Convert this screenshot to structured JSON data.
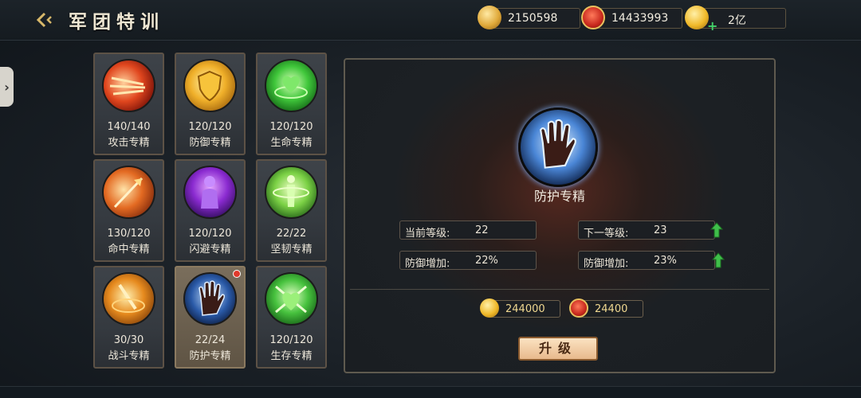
{
  "header": {
    "back_icon": "back-arrow-icon",
    "title": "军团特训"
  },
  "resources": [
    {
      "icon": "gold-ingot-icon",
      "value": "2150598"
    },
    {
      "icon": "red-medal-icon",
      "value": "14433993"
    },
    {
      "icon": "gold-coin-icon",
      "value": "2亿",
      "has_plus": true
    }
  ],
  "side_tab": {
    "icon": "chevron-right-icon",
    "glyph": "›"
  },
  "skills": [
    {
      "level": "140/140",
      "name": "攻击专精",
      "icon": "attack-icon"
    },
    {
      "level": "120/120",
      "name": "防御专精",
      "icon": "shield-icon"
    },
    {
      "level": "120/120",
      "name": "生命专精",
      "icon": "heart-icon"
    },
    {
      "level": "130/120",
      "name": "命中专精",
      "icon": "arrow-icon"
    },
    {
      "level": "120/120",
      "name": "闪避专精",
      "icon": "shadow-figure-icon"
    },
    {
      "level": "22/22",
      "name": "坚韧专精",
      "icon": "figure-ring-icon"
    },
    {
      "level": "30/30",
      "name": "战斗专精",
      "icon": "sword-swirl-icon"
    },
    {
      "level": "22/24",
      "name": "防护专精",
      "icon": "hand-icon",
      "selected": true,
      "notify": true
    },
    {
      "level": "120/120",
      "name": "生存专精",
      "icon": "heart-cross-icon"
    }
  ],
  "detail": {
    "icon": "hand-icon",
    "name": "防护专精",
    "current_level_label": "当前等级:",
    "current_level": "22",
    "next_level_label": "下一等级:",
    "next_level": "23",
    "current_bonus_label": "防御增加:",
    "current_bonus": "22%",
    "next_bonus_label": "防御增加:",
    "next_bonus": "23%",
    "cost_coin": "244000",
    "cost_medal": "24400",
    "upgrade_label": "升级"
  },
  "colors": {
    "accent_gold": "#d8b86a",
    "up_arrow": "#3fbf4a",
    "notify_dot": "#e03a2c"
  }
}
